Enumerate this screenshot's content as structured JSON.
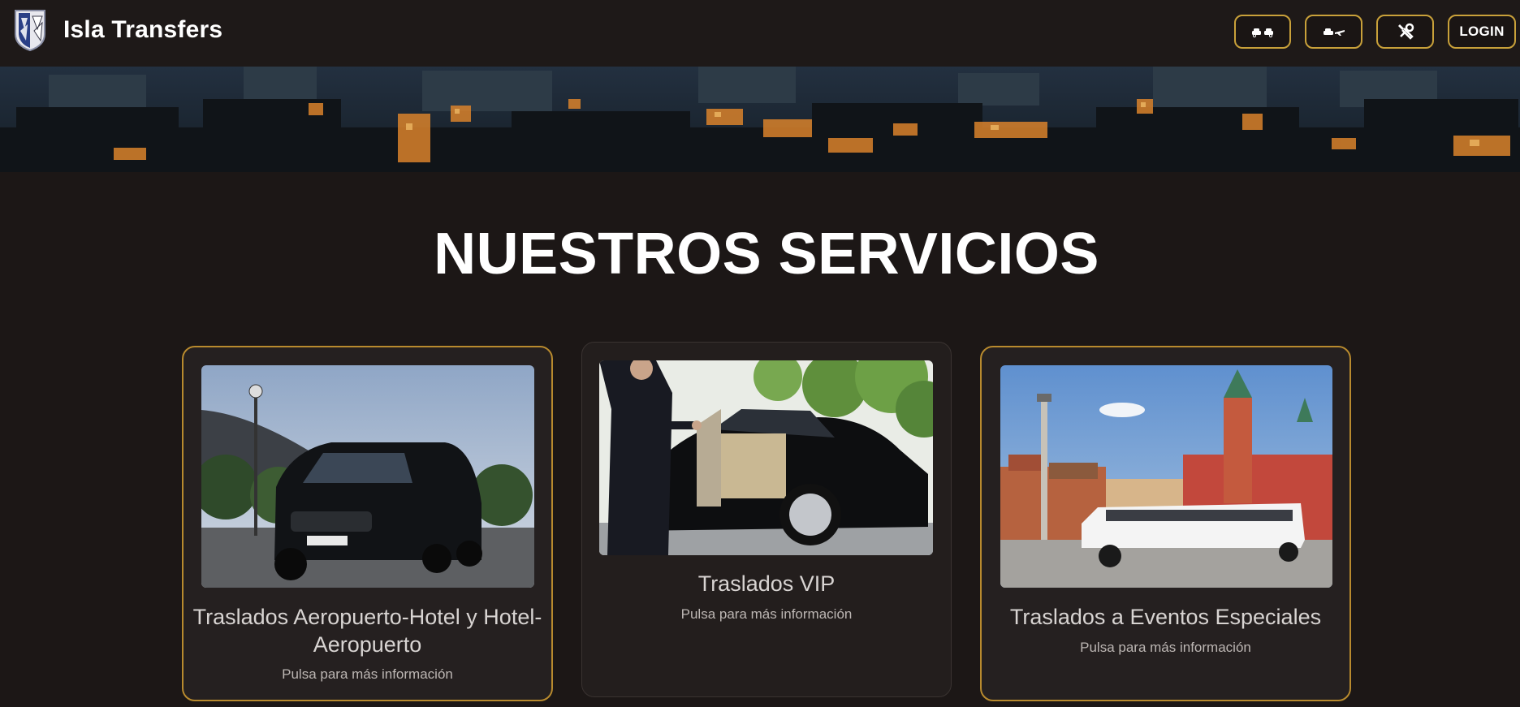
{
  "header": {
    "brand": "Isla Transfers",
    "nav_icons": [
      "car-transfer-icon",
      "plane-transfer-icon",
      "settings-tools-icon"
    ],
    "login_label": "LOGIN"
  },
  "main": {
    "title": "NUESTROS SERVICIOS",
    "cards": [
      {
        "title": "Traslados Aeropuerto-Hotel y Hotel-Aeropuerto",
        "subtitle": "Pulsa para más información",
        "image": "black-van-photo"
      },
      {
        "title": "Traslados VIP",
        "subtitle": "Pulsa para más información",
        "image": "chauffeur-sedan-photo"
      },
      {
        "title": "Traslados a Eventos Especiales",
        "subtitle": "Pulsa para más información",
        "image": "white-limousine-photo"
      }
    ]
  },
  "colors": {
    "background": "#1c1716",
    "accent_gold": "#c9a13a",
    "text": "#ffffff"
  }
}
